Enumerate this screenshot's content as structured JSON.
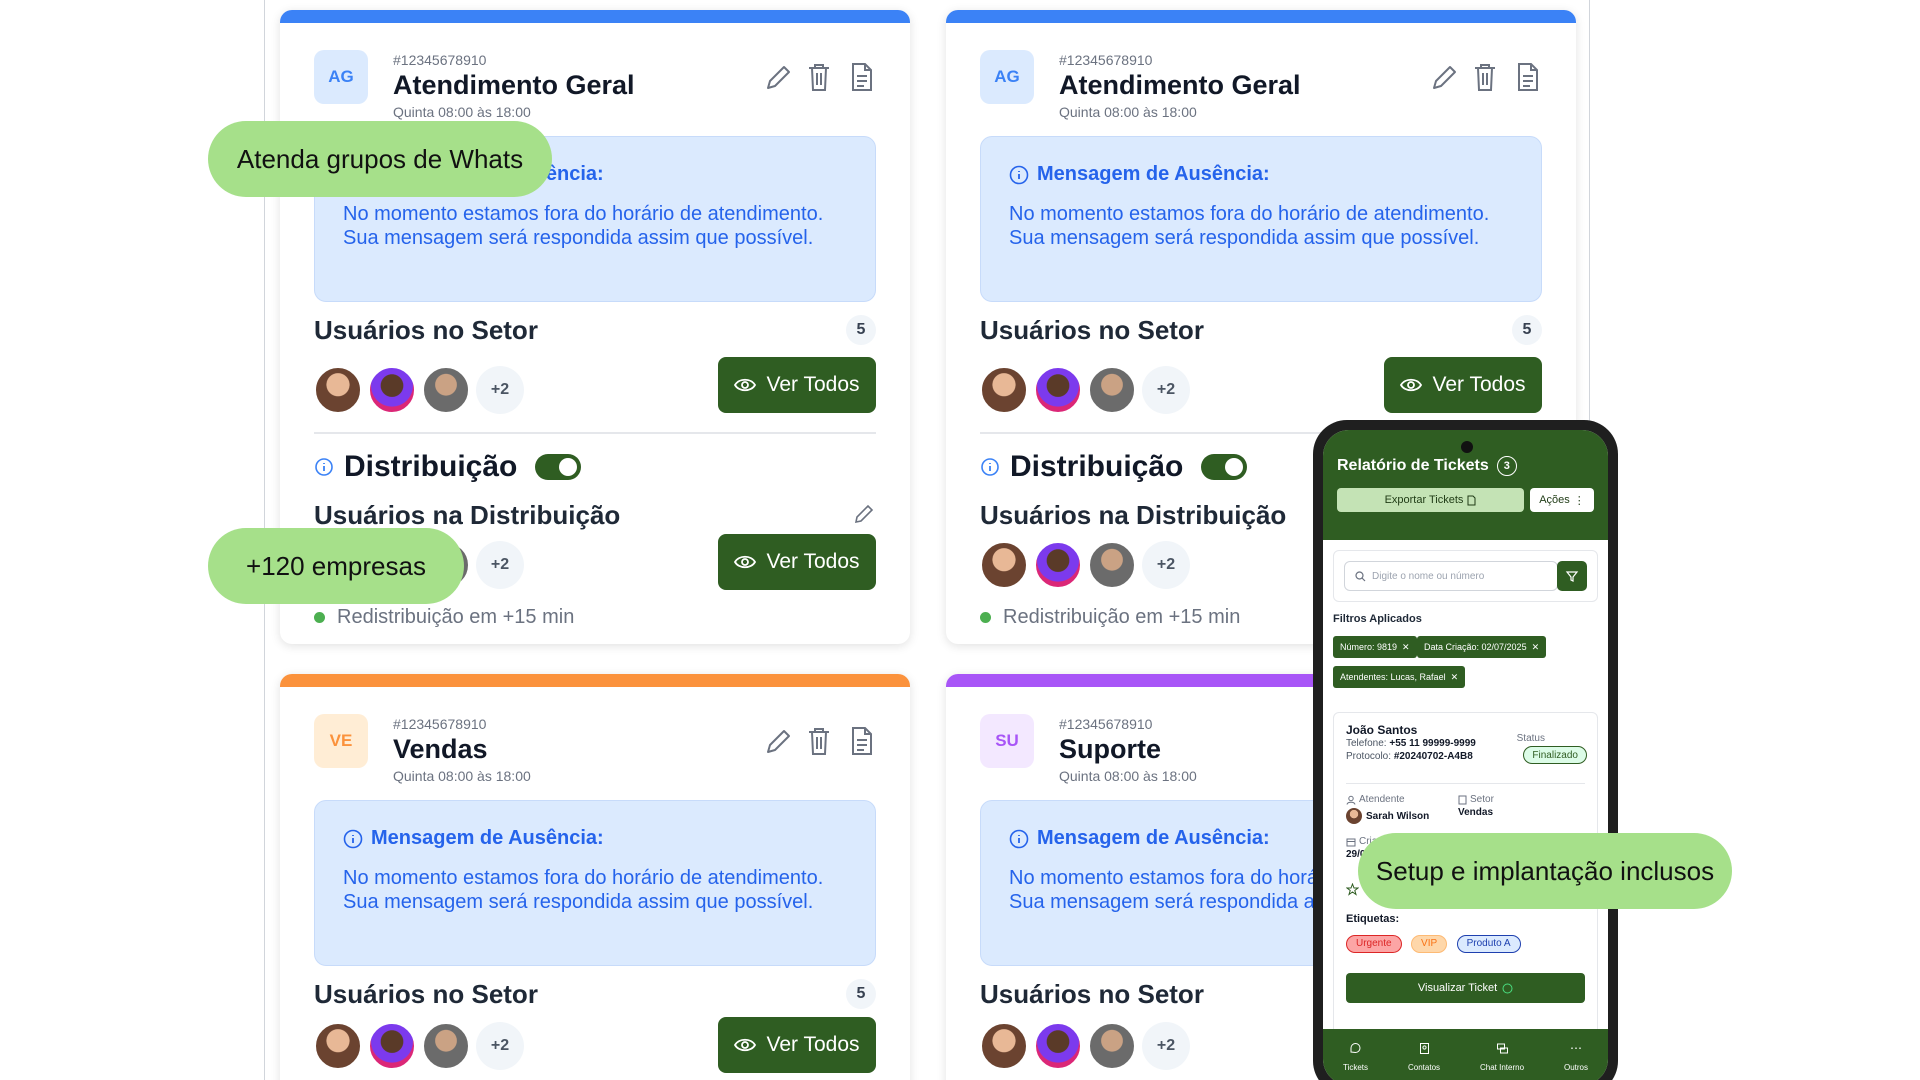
{
  "cards": [
    {
      "avatar": "AG",
      "id": "#12345678910",
      "title": "Atendimento Geral",
      "hours": "Quinta 08:00 às 18:00",
      "bar_color": "#3b82f6",
      "avatar_bg": "#dbeafe",
      "avatar_fg": "#3b82f6",
      "away_title": "Mensagem de Ausência:",
      "away_text": "No momento estamos fora do horário de atendimento. Sua mensagem será respondida assim que possível.",
      "users_title": "Usuários no Setor",
      "users_count": "5",
      "more": "+2",
      "button": "Ver Todos",
      "dist_label": "Distribuição",
      "dist_users_title": "Usuários na Distribuição",
      "dist_more": "+2",
      "dist_button": "Ver Todos",
      "redistribution": "Redistribuição em +15 min"
    },
    {
      "avatar": "AG",
      "id": "#12345678910",
      "title": "Atendimento Geral",
      "hours": "Quinta 08:00 às 18:00",
      "bar_color": "#3b82f6",
      "avatar_bg": "#dbeafe",
      "avatar_fg": "#3b82f6",
      "away_title": "Mensagem de Ausência:",
      "away_text": "No momento estamos fora do horário de atendimento. Sua mensagem será respondida assim que possível.",
      "users_title": "Usuários no Setor",
      "users_count": "5",
      "more": "+2",
      "button": "Ver Todos",
      "dist_label": "Distribuição",
      "dist_users_title": "Usuários na Distribuição",
      "dist_more": "+2",
      "redistribution": "Redistribuição em +15 min"
    },
    {
      "avatar": "VE",
      "id": "#12345678910",
      "title": "Vendas",
      "hours": "Quinta 08:00 às 18:00",
      "bar_color": "#fb923c",
      "avatar_bg": "#ffedd5",
      "avatar_fg": "#fb923c",
      "away_title": "Mensagem de Ausência:",
      "away_text": "No momento estamos fora do horário de atendimento. Sua mensagem será respondida assim que possível.",
      "users_title": "Usuários no Setor",
      "users_count": "5",
      "more": "+2",
      "button": "Ver Todos"
    },
    {
      "avatar": "SU",
      "id": "#12345678910",
      "title": "Suporte",
      "hours": "Quinta 08:00 às 18:00",
      "bar_color": "#a855f7",
      "avatar_bg": "#f3e8ff",
      "avatar_fg": "#a855f7",
      "away_title": "Mensagem de Ausência:",
      "away_text": "No momento estamos fora do horário de atendimento. Sua mensagem será respondida assim que possível.",
      "users_title": "Usuários no Setor",
      "more": "+2"
    }
  ],
  "pills": {
    "whats": "Atenda grupos de Whats",
    "empresas": "+120 empresas",
    "setup": "Setup e implantação inclusos"
  },
  "phone": {
    "title": "Relatório de Tickets",
    "count": "3",
    "export": "Exportar Tickets",
    "actions": "Ações",
    "search_placeholder": "Digite o nome ou número",
    "filters_label": "Filtros Aplicados",
    "chips": [
      "Número: 9819",
      "Data Criação: 02/07/2025",
      "Atendentes: Lucas, Rafael"
    ],
    "ticket": {
      "name": "João Santos",
      "phone_label": "Telefone:",
      "phone": "+55 11 99999-9999",
      "protocol_label": "Protocolo:",
      "protocol": "#20240702-A4B8",
      "status_label": "Status",
      "status": "Finalizado",
      "agent_label": "Atendente",
      "agent": "Sarah Wilson",
      "sector_label": "Setor",
      "sector": "Vendas",
      "created_label": "Cria",
      "created": "29/0",
      "tags_label": "Etiquetas:",
      "tags": [
        "Urgente",
        "VIP",
        "Produto A"
      ],
      "view_button": "Visualizar Ticket"
    },
    "nav": [
      "Tickets",
      "Contatos",
      "Chat Interno",
      "Outros"
    ],
    "colors": {
      "primary": "#2f5d22",
      "pill": "#a6e08a"
    }
  }
}
